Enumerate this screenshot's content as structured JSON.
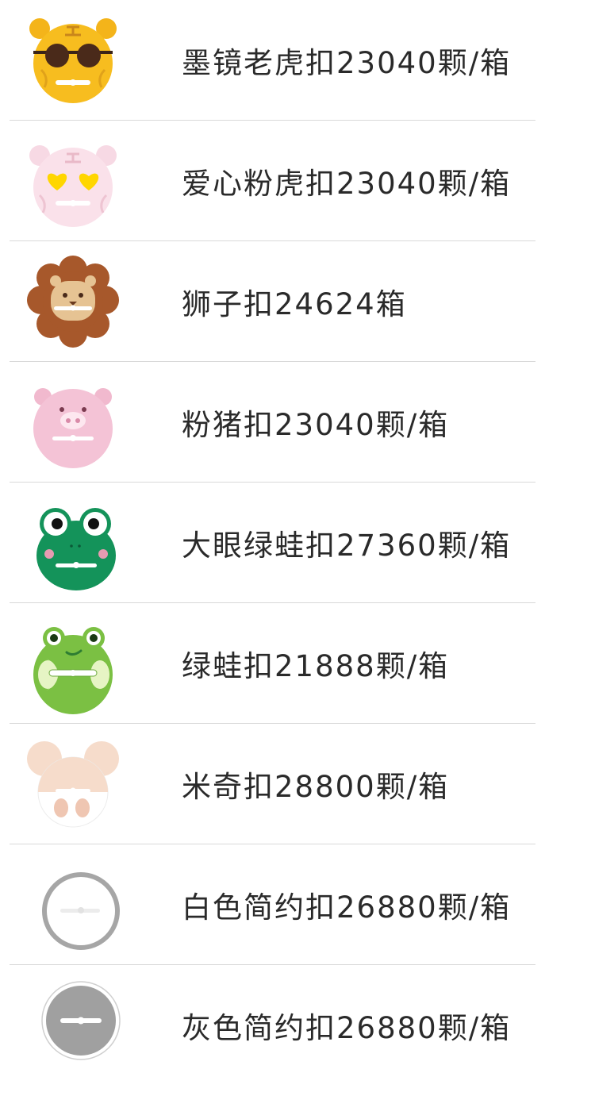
{
  "products": [
    {
      "label": "墨镜老虎扣23040颗/箱",
      "icon": "sunglasses-tiger-icon"
    },
    {
      "label": "爱心粉虎扣23040颗/箱",
      "icon": "heart-eyes-pink-tiger-icon"
    },
    {
      "label": "狮子扣24624箱",
      "icon": "lion-icon"
    },
    {
      "label": "粉猪扣23040颗/箱",
      "icon": "pink-pig-icon"
    },
    {
      "label": "大眼绿蛙扣27360颗/箱",
      "icon": "big-eyed-frog-icon"
    },
    {
      "label": "绿蛙扣21888颗/箱",
      "icon": "green-frog-icon"
    },
    {
      "label": "米奇扣28800颗/箱",
      "icon": "mouse-icon"
    },
    {
      "label": "白色简约扣26880颗/箱",
      "icon": "white-ring-icon"
    },
    {
      "label": "灰色简约扣26880颗/箱",
      "icon": "gray-disc-icon"
    }
  ]
}
